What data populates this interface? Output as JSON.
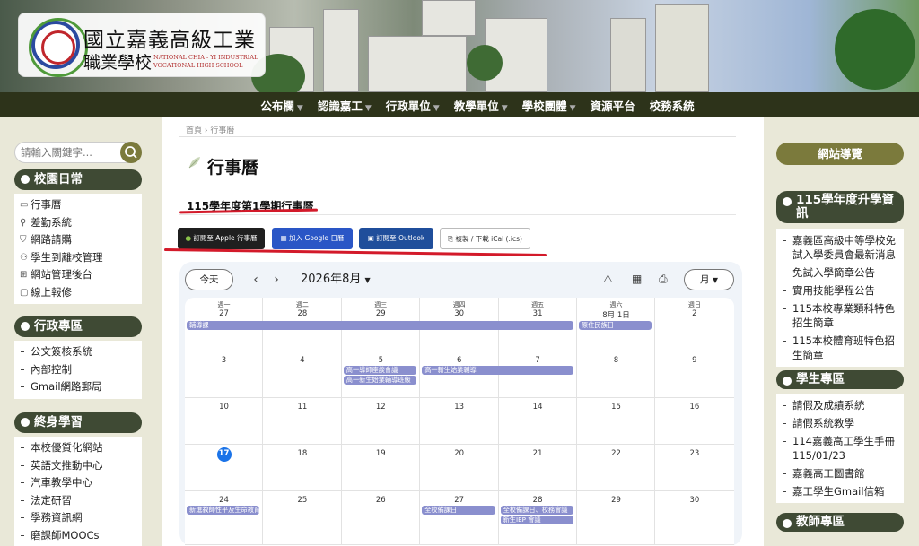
{
  "header": {
    "school_name_zh_line1": "國立嘉義高級工業",
    "school_name_zh_line2": "職業學校",
    "school_name_en_line1": "NATIONAL CHIA - YI INDUSTRIAL",
    "school_name_en_line2": "VOCATIONAL HIGH SCHOOL"
  },
  "nav": [
    {
      "label": "公布欄",
      "dropdown": true
    },
    {
      "label": "認識嘉工",
      "dropdown": true
    },
    {
      "label": "行政單位",
      "dropdown": true
    },
    {
      "label": "教學單位",
      "dropdown": true
    },
    {
      "label": "學校團體",
      "dropdown": true
    },
    {
      "label": "資源平台",
      "dropdown": false
    },
    {
      "label": "校務系統",
      "dropdown": false
    }
  ],
  "search": {
    "placeholder": "請輸入關鍵字..."
  },
  "left_sidebar": [
    {
      "title": "校園日常",
      "items": [
        "行事曆",
        "差勤系統",
        "網路請購",
        "學生到離校管理",
        "網站管理後台",
        "線上報修"
      ]
    },
    {
      "title": "行政專區",
      "items": [
        "公文簽核系統",
        "內部控制",
        "Gmail網路郵局"
      ]
    },
    {
      "title": "終身學習",
      "items": [
        "本校優質化網站",
        "英語文推動中心",
        "汽車教學中心",
        "法定研習",
        "學務資訊網",
        "磨課師MOOCs"
      ]
    }
  ],
  "main": {
    "breadcrumb": "首頁  ›  行事曆",
    "title": "行事曆",
    "semester_title": "115學年度第1學期行事曆",
    "subscribe": {
      "apple": "訂閱至 Apple 行事曆",
      "google": "加入 Google 日曆",
      "outlook": "訂閱至 Outlook",
      "ical": "複製 / 下載 iCal (.ics)"
    }
  },
  "calendar": {
    "today_label": "今天",
    "month_label": "2026年8月",
    "view_label": "月",
    "weekdays": [
      "週一",
      "週二",
      "週三",
      "週四",
      "週五",
      "週六",
      "週日"
    ],
    "weeks": [
      [
        "27",
        "28",
        "29",
        "30",
        "31",
        "8月 1日",
        "2"
      ],
      [
        "3",
        "4",
        "5",
        "6",
        "7",
        "8",
        "9"
      ],
      [
        "10",
        "11",
        "12",
        "13",
        "14",
        "15",
        "16"
      ],
      [
        "17",
        "18",
        "19",
        "20",
        "21",
        "22",
        "23"
      ],
      [
        "24",
        "25",
        "26",
        "27",
        "28",
        "29",
        "30"
      ]
    ],
    "today": {
      "week": 3,
      "day": 0
    },
    "events": [
      {
        "title": "輔導課",
        "week": 0,
        "start": 0,
        "span": 5,
        "row": 0
      },
      {
        "title": "原住民族日",
        "week": 0,
        "start": 5,
        "span": 1,
        "row": 0
      },
      {
        "title": "高一導師座談會議",
        "week": 1,
        "start": 2,
        "span": 1,
        "row": 0
      },
      {
        "title": "高一新生始業輔導",
        "week": 1,
        "start": 3,
        "span": 2,
        "row": 0
      },
      {
        "title": "高一新生始業輔導班級",
        "week": 1,
        "start": 2,
        "span": 1,
        "row": 1
      },
      {
        "title": "新進教師性平及生命教育",
        "week": 4,
        "start": 0,
        "span": 1,
        "row": 0
      },
      {
        "title": "全校備課日",
        "week": 4,
        "start": 3,
        "span": 1,
        "row": 0
      },
      {
        "title": "全校備課日、校務會議",
        "week": 4,
        "start": 4,
        "span": 1,
        "row": 0
      },
      {
        "title": "新生IEP 會議",
        "week": 4,
        "start": 4,
        "span": 1,
        "row": 1
      }
    ]
  },
  "right_sidebar": {
    "nav_guide": "網站導覽",
    "sections": [
      {
        "title": "115學年度升學資訊",
        "items": [
          "嘉義區高級中等學校免試入學委員會最新消息",
          "免試入學簡章公告",
          "實用技能學程公告",
          "115本校專業類科特色招生簡章",
          "115本校體育班特色招生簡章"
        ]
      },
      {
        "title": "學生專區",
        "items": [
          "請假及成績系統",
          "請假系統教學",
          "114嘉義高工學生手冊 115/01/23",
          "嘉義高工圖書館",
          "嘉工學生Gmail信箱"
        ]
      },
      {
        "title": "教師專區",
        "items": []
      }
    ]
  },
  "colors": {
    "nav_bg": "#2d331a",
    "sidebar_head": "#3f4a34",
    "olive": "#7b7a3c",
    "event": "#8a8fce",
    "today": "#1a73e8",
    "accent_red": "#d31a2a"
  }
}
